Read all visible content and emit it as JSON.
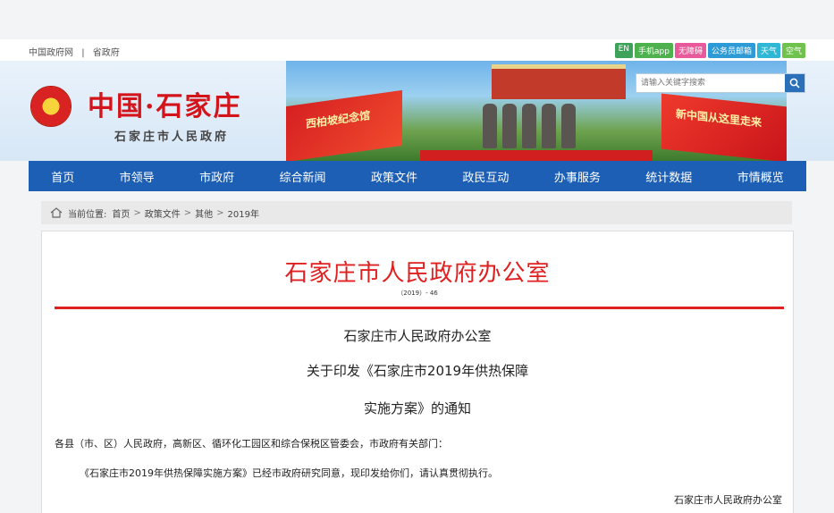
{
  "topbar": {
    "links": [
      "中国政府网",
      "|",
      "省政府"
    ],
    "quick": [
      {
        "label": "EN",
        "color": "#3da35a"
      },
      {
        "label": "手机app",
        "color": "#4db24d"
      },
      {
        "label": "无障碍",
        "color": "#e85a9b"
      },
      {
        "label": "公务员邮箱",
        "color": "#2e9bd6"
      },
      {
        "label": "天气",
        "color": "#2eb8d6"
      },
      {
        "label": "空气",
        "color": "#6fc24b"
      }
    ]
  },
  "header": {
    "title": "中国·石家庄",
    "subtitle": "石家庄市人民政府",
    "flag_left_text": "西柏坡纪念馆",
    "flag_right_text": "新中国从这里走来",
    "search_placeholder": "请输入关键字搜索"
  },
  "nav": {
    "items": [
      "首页",
      "市领导",
      "市政府",
      "综合新闻",
      "政策文件",
      "政民互动",
      "办事服务",
      "统计数据",
      "市情概览"
    ]
  },
  "breadcrumb": {
    "prefix": "当前位置:",
    "items": [
      "首页",
      "政策文件",
      "其他",
      "2019年"
    ],
    "sep": ">"
  },
  "document": {
    "issuer": "石家庄市人民政府办公室",
    "number": "（2019）- 46",
    "title_line1": "石家庄市人民政府办公室",
    "title_line2": "关于印发《石家庄市2019年供热保障",
    "title_line3": "实施方案》的通知",
    "recipients": "各县（市、区）人民政府，高新区、循环化工园区和综合保税区管委会，市政府有关部门：",
    "body": "《石家庄市2019年供热保障实施方案》已经市政府研究同意，现印发给你们，请认真贯彻执行。",
    "signature": "石家庄市人民政府办公室"
  },
  "colors": {
    "nav_bg": "#1d5fb4",
    "accent_red": "#e02020"
  }
}
